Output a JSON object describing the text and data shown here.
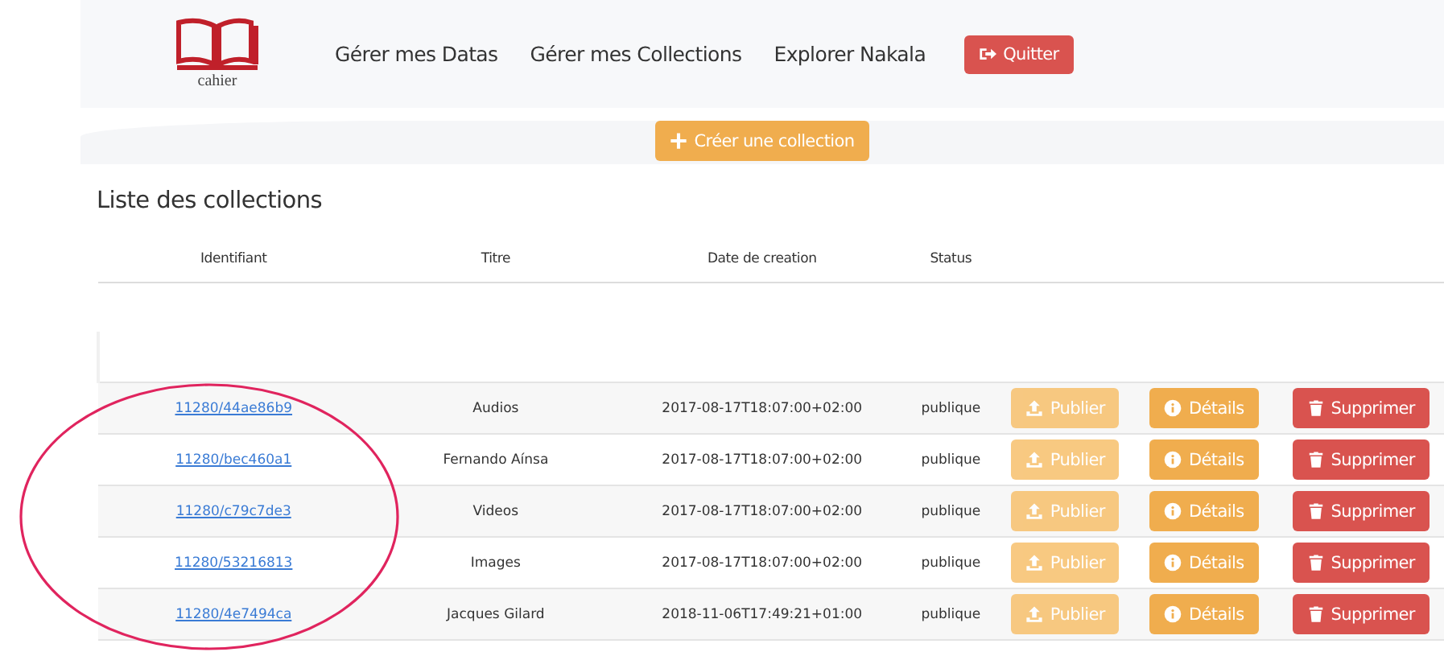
{
  "logo": {
    "caption": "cahier"
  },
  "nav": [
    {
      "label": "Gérer mes Datas"
    },
    {
      "label": "Gérer mes Collections"
    },
    {
      "label": "Explorer Nakala"
    }
  ],
  "quit_button": {
    "label": "Quitter"
  },
  "create_button": {
    "label": "Créer une collection"
  },
  "title": "Liste des collections",
  "table": {
    "columns": [
      "Identifiant",
      "Titre",
      "Date de creation",
      "Status"
    ],
    "rows": [
      {
        "id": "11280/44ae86b9",
        "title": "Audios",
        "date": "2017-08-17T18:07:00+02:00",
        "status": "publique",
        "publish": "Publier",
        "publish_disabled": true,
        "details": "Détails",
        "delete": "Supprimer"
      },
      {
        "id": "11280/bec460a1",
        "title": "Fernando Aínsa",
        "date": "2017-08-17T18:07:00+02:00",
        "status": "publique",
        "publish": "Publier",
        "publish_disabled": true,
        "details": "Détails",
        "delete": "Supprimer"
      },
      {
        "id": "11280/c79c7de3",
        "title": "Videos",
        "date": "2017-08-17T18:07:00+02:00",
        "status": "publique",
        "publish": "Publier",
        "publish_disabled": true,
        "details": "Détails",
        "delete": "Supprimer"
      },
      {
        "id": "11280/53216813",
        "title": "Images",
        "date": "2017-08-17T18:07:00+02:00",
        "status": "publique",
        "publish": "Publier",
        "publish_disabled": true,
        "details": "Détails",
        "delete": "Supprimer"
      },
      {
        "id": "11280/4e7494ca",
        "title": "Jacques Gilard",
        "date": "2018-11-06T17:49:21+01:00",
        "status": "publique",
        "publish": "Publier",
        "publish_disabled": true,
        "details": "Détails",
        "delete": "Supprimer"
      }
    ]
  }
}
